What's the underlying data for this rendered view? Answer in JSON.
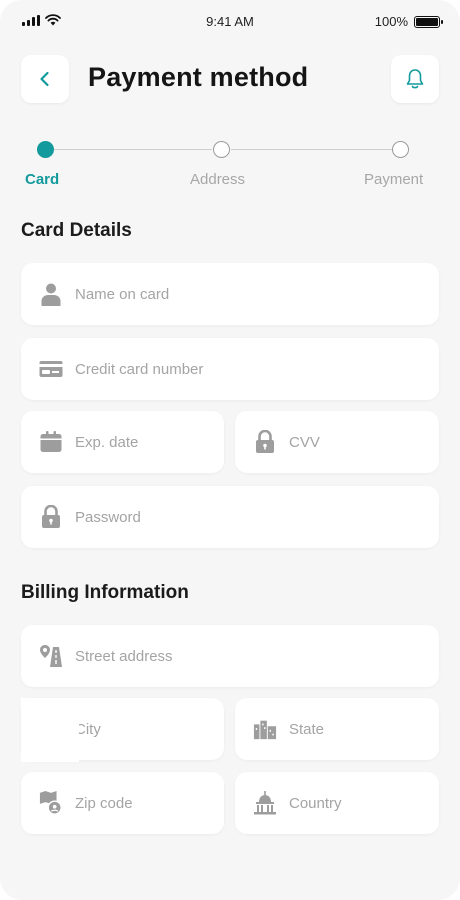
{
  "status": {
    "time": "9:41 AM",
    "battery": "100%",
    "battery_level": 1.0
  },
  "header": {
    "title": "Payment method",
    "back_icon": "chevron-left-icon",
    "bell_icon": "bell-icon"
  },
  "stepper": {
    "steps": [
      "Card",
      "Address",
      "Payment"
    ],
    "active_index": 0
  },
  "colors": {
    "accent": "#139a9c",
    "background": "#f6f6f6",
    "card": "#ffffff",
    "placeholder": "#a4a4a4"
  },
  "card_details": {
    "title": "Card Details",
    "name_placeholder": "Name on card",
    "number_placeholder": "Credit card number",
    "exp_placeholder": "Exp. date",
    "cvv_placeholder": "CVV",
    "password_placeholder": "Password"
  },
  "billing": {
    "title": "Billing Information",
    "street_placeholder": "Street address",
    "city_placeholder": "City",
    "state_placeholder": "State",
    "zip_placeholder": "Zip code",
    "country_placeholder": "Country"
  }
}
